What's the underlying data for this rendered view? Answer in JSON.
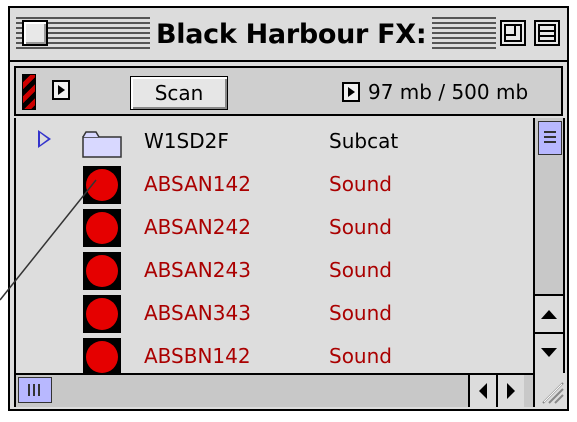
{
  "window": {
    "title": "Black Harbour FX:"
  },
  "toolbar": {
    "scan_label": "Scan",
    "memory": "97 mb / 500 mb"
  },
  "rows": [
    {
      "kind": "folder",
      "name": "W1SD2F",
      "type": "Subcat",
      "icon": "folder-icon"
    },
    {
      "kind": "sound",
      "name": "ABSAN142",
      "type": "Sound",
      "icon": "sound-icon"
    },
    {
      "kind": "sound",
      "name": "ABSAN242",
      "type": "Sound",
      "icon": "sound-icon"
    },
    {
      "kind": "sound",
      "name": "ABSAN243",
      "type": "Sound",
      "icon": "sound-icon"
    },
    {
      "kind": "sound",
      "name": "ABSAN343",
      "type": "Sound",
      "icon": "sound-icon"
    },
    {
      "kind": "sound",
      "name": "ABSBN142",
      "type": "Sound",
      "icon": "sound-icon"
    }
  ],
  "colors": {
    "sound_text": "#aa0000",
    "sound_dot": "#e50000",
    "scroll_thumb": "#b8b8ff",
    "disclosure": "#3333cc"
  }
}
